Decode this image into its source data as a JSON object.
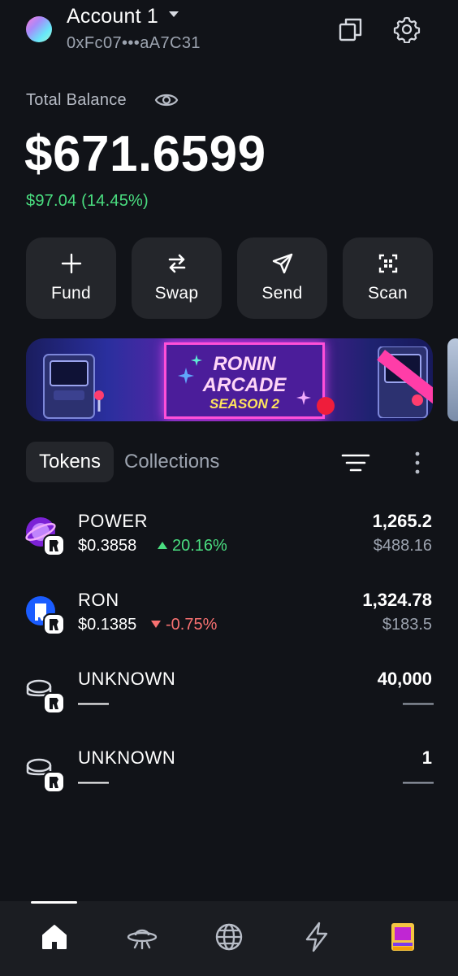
{
  "header": {
    "account_name": "Account 1",
    "address": "0xFc07•••aA7C31"
  },
  "balance": {
    "label": "Total Balance",
    "value": "$671.6599",
    "change": "$97.04 (14.45%)"
  },
  "actions": [
    {
      "label": "Fund",
      "icon": "plus-icon"
    },
    {
      "label": "Swap",
      "icon": "swap-icon"
    },
    {
      "label": "Send",
      "icon": "send-icon"
    },
    {
      "label": "Scan",
      "icon": "scan-icon"
    }
  ],
  "banner": {
    "line1": "RONIN",
    "line2": "ARCADE",
    "line3": "SEASON 2"
  },
  "tabs": {
    "tokens": "Tokens",
    "collections": "Collections",
    "active": "Tokens"
  },
  "tokens": [
    {
      "name": "POWER",
      "price": "$0.3858",
      "change": "20.16%",
      "direction": "up",
      "amount": "1,265.2",
      "usd": "$488.16",
      "icon": "power-token-icon"
    },
    {
      "name": "RON",
      "price": "$0.1385",
      "change": "-0.75%",
      "direction": "down",
      "amount": "1,324.78",
      "usd": "$183.5",
      "icon": "ron-token-icon"
    },
    {
      "name": "UNKNOWN",
      "price": "——",
      "change": "",
      "direction": "",
      "amount": "40,000",
      "usd": "——",
      "icon": "unknown-token-icon"
    },
    {
      "name": "UNKNOWN",
      "price": "——",
      "change": "",
      "direction": "",
      "amount": "1",
      "usd": "——",
      "icon": "unknown-token-icon"
    }
  ],
  "bottom_nav": {
    "items": [
      "home-icon",
      "ufo-icon",
      "globe-icon",
      "lightning-icon",
      "arcade-icon"
    ],
    "active": "home-icon"
  },
  "colors": {
    "background": "#111318",
    "positive": "#4ade80",
    "negative": "#f87171",
    "card": "#24262b"
  }
}
